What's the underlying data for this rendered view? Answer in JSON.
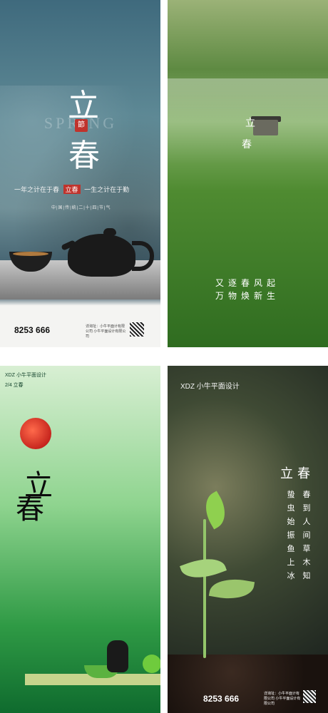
{
  "panel1": {
    "watermark": "SPRING",
    "char_li": "立",
    "char_chun": "春",
    "seal": "節",
    "slogan_left": "一年之计在于春",
    "slogan_mid": "立春",
    "slogan_right": "一生之计在于勤",
    "terms": "中|国|传|统|二|十|四|节|气",
    "phone": "8253 666",
    "address": "详询址：小牛平面计有限公司 小牛平面设计有限公司"
  },
  "panel2": {
    "char_li": "立",
    "char_chun": "春",
    "line1": "又逐春风起",
    "line2": "万物焕新生"
  },
  "panel3": {
    "brand": "XDZ 小牛平面设计",
    "date": "2/4 立春",
    "char_li": "立",
    "char_chun": "春"
  },
  "panel4": {
    "brand": "XDZ 小牛平面设计",
    "title": "立春",
    "col1": "蛰虫始振鱼上冰",
    "col2": "春到人间草木知",
    "phone": "8253 666",
    "address": "详询址：小牛平面计有限公司 小牛平面设计有限公司"
  }
}
